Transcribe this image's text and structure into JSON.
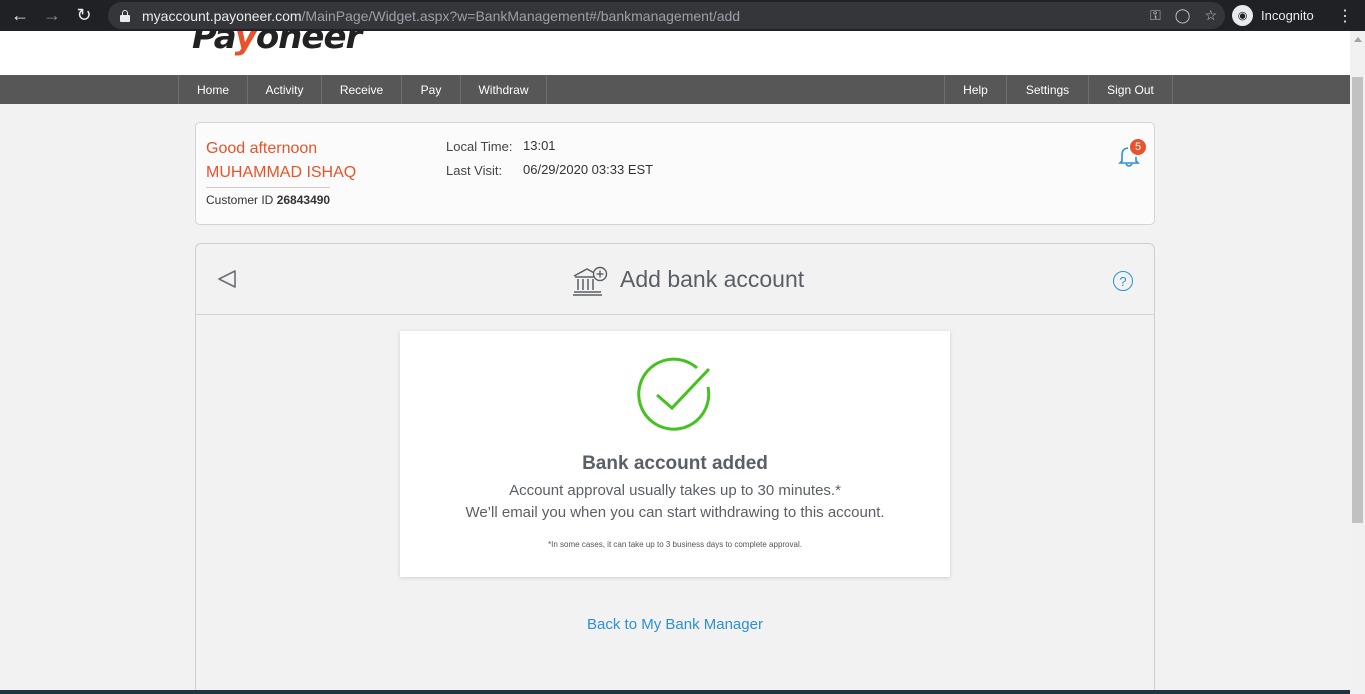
{
  "browser": {
    "url_host": "myaccount.payoneer.com",
    "url_path": "/MainPage/Widget.aspx?w=BankManagement#/bankmanagement/add",
    "profile_label": "Incognito"
  },
  "header": {
    "logo_left": "Pa",
    "logo_mark": "y",
    "logo_right": "oneer"
  },
  "nav": {
    "left_items": [
      "Home",
      "Activity",
      "Receive",
      "Pay",
      "Withdraw"
    ],
    "right_items": [
      "Help",
      "Settings",
      "Sign Out"
    ]
  },
  "greeting": {
    "salutation": "Good afternoon",
    "name": "MUHAMMAD ISHAQ",
    "customer_id_label": "Customer ID",
    "customer_id": "26843490",
    "local_time_label": "Local Time:",
    "local_time": "13:01",
    "last_visit_label": "Last Visit:",
    "last_visit": "06/29/2020 03:33 EST",
    "notification_count": "5"
  },
  "panel": {
    "title": "Add bank account",
    "help_glyph": "?",
    "success_title": "Bank account added",
    "success_line1": "Account approval usually takes up to 30 minutes.*",
    "success_line2": "We’ll email you when you can start withdrawing to this account.",
    "success_note": "*In some cases, it can take up to 3 business days to complete approval.",
    "back_link": "Back to My Bank Manager"
  },
  "colors": {
    "brand_orange": "#e8532b",
    "link_blue": "#2d8fd5",
    "success_green": "#44c21f",
    "nav_gray": "#575757"
  }
}
